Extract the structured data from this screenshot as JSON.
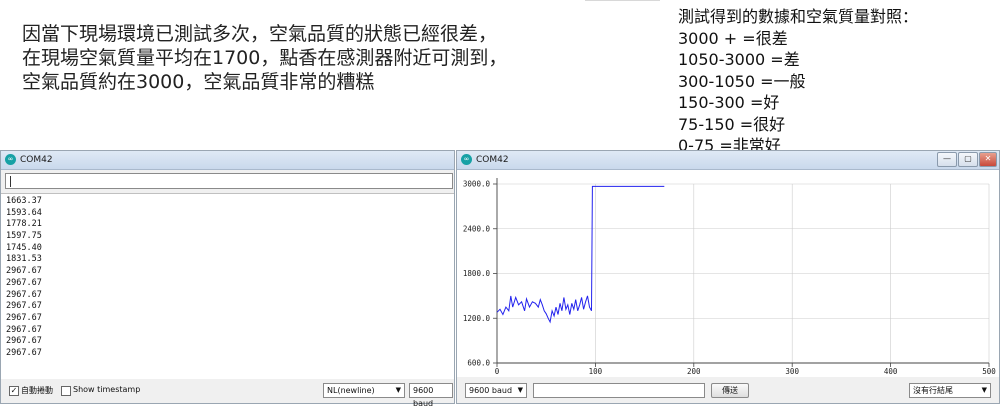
{
  "notes": {
    "left_lines": [
      "因當下現場環境已測試多次，空氣品質的狀態已經很差，",
      "在現場空氣質量平均在1700，點香在感測器附近可測到，",
      "空氣品質約在3000，空氣品質非常的糟糕"
    ],
    "right_lines": [
      "測試得到的數據和空氣質量對照：",
      "3000 + =很差",
      "1050-3000 =差",
      "300-1050 =一般",
      "150-300 =好",
      "75-150 =很好",
      "0-75 =非常好"
    ]
  },
  "serial_monitor": {
    "title": "COM42",
    "logo": "∞",
    "input_value": "",
    "output_lines": [
      "1663.37",
      "1593.64",
      "1778.21",
      "1597.75",
      "1745.40",
      "1831.53",
      "2967.67",
      "2967.67",
      "2967.67",
      "2967.67",
      "2967.67",
      "2967.67",
      "2967.67",
      "2967.67"
    ],
    "autoscroll_checked": true,
    "autoscroll_label": "自動捲動",
    "timestamp_checked": false,
    "timestamp_label": "Show timestamp",
    "line_ending": "NL(newline)",
    "baud": "9600 baud"
  },
  "serial_plotter": {
    "title": "COM42",
    "logo": "∞",
    "window_buttons": [
      "—",
      "▢"
    ],
    "baud": "9600 baud",
    "send_value": "",
    "send_label": "傳送",
    "line_ending": "沒有行結尾",
    "colors": {
      "line": "#2222ee",
      "axis": "#444444",
      "grid": "#cccccc"
    }
  },
  "chart_data": {
    "type": "line",
    "title": "",
    "xlabel": "",
    "ylabel": "",
    "xlim": [
      0,
      500
    ],
    "ylim": [
      600,
      3000
    ],
    "x_ticks": [
      0,
      100,
      200,
      300,
      400,
      500
    ],
    "y_ticks": [
      "600.0",
      "1200.0",
      "1800.0",
      "2400.0",
      "3000.0"
    ],
    "y_tick_values": [
      600,
      1200,
      1800,
      2400,
      3000
    ],
    "grid": true,
    "series": [
      {
        "name": "",
        "x": [
          0,
          3,
          6,
          9,
          12,
          14,
          16,
          19,
          22,
          25,
          28,
          30,
          33,
          36,
          39,
          42,
          44,
          46,
          48,
          50,
          52,
          54,
          56,
          58,
          60,
          62,
          64,
          66,
          68,
          70,
          72,
          74,
          76,
          78,
          80,
          82,
          84,
          86,
          88,
          90,
          92,
          94,
          96,
          97,
          98,
          100,
          102,
          104,
          106,
          108,
          110,
          115,
          120,
          125,
          130,
          135,
          140,
          145,
          150,
          155,
          160,
          165,
          170
        ],
        "y": [
          1280,
          1320,
          1250,
          1350,
          1300,
          1500,
          1350,
          1480,
          1380,
          1420,
          1300,
          1460,
          1350,
          1420,
          1400,
          1350,
          1450,
          1380,
          1300,
          1260,
          1200,
          1150,
          1300,
          1230,
          1350,
          1250,
          1400,
          1300,
          1480,
          1320,
          1380,
          1250,
          1400,
          1320,
          1450,
          1300,
          1380,
          1480,
          1320,
          1420,
          1500,
          1350,
          1300,
          2967.67,
          2967.67,
          2967.67,
          2967.67,
          2967.67,
          2967.67,
          2967.67,
          2967.67,
          2967.67,
          2967.67,
          2967.67,
          2967.67,
          2967.67,
          2967.67,
          2967.67,
          2967.67,
          2967.67,
          2967.67,
          2967.67,
          2967.67
        ]
      }
    ]
  }
}
